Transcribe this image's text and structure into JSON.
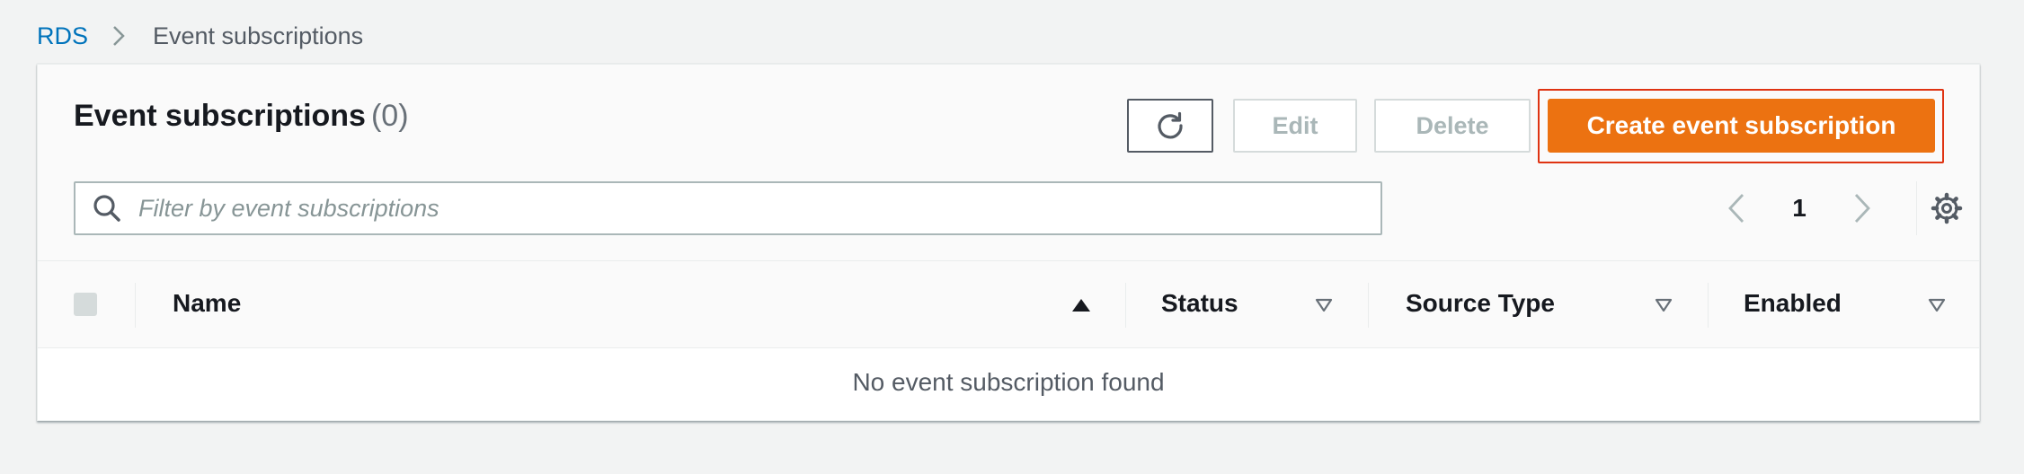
{
  "breadcrumb": {
    "root": "RDS",
    "current": "Event subscriptions"
  },
  "panel": {
    "title": "Event subscriptions",
    "count": "(0)"
  },
  "actions": {
    "edit_label": "Edit",
    "delete_label": "Delete",
    "create_label": "Create event subscription"
  },
  "search": {
    "placeholder": "Filter by event subscriptions",
    "value": ""
  },
  "pagination": {
    "current_page": "1"
  },
  "table": {
    "columns": [
      "Name",
      "Status",
      "Source Type",
      "Enabled"
    ],
    "empty_message": "No event subscription found"
  },
  "colors": {
    "primary": "#ec7211",
    "link": "#0073bb",
    "highlight": "#df3312",
    "background": "#f2f3f3"
  },
  "icons": {
    "breadcrumb_separator": "chevron-right-icon",
    "refresh": "refresh-icon",
    "search": "search-icon",
    "prev": "chevron-left-icon",
    "next": "chevron-right-icon",
    "settings": "gear-icon",
    "sort_asc": "caret-up-icon",
    "sort_none": "caret-down-outline-icon"
  }
}
